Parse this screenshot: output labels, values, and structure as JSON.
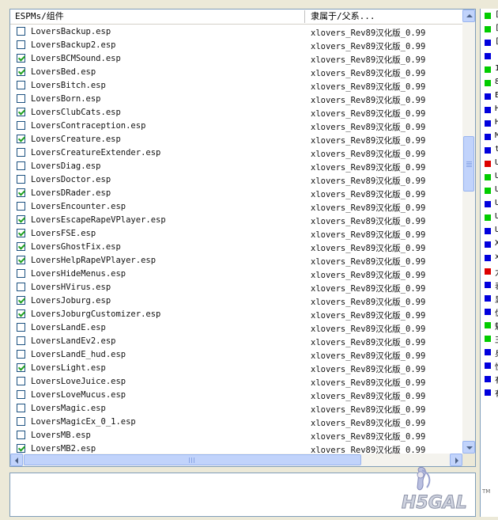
{
  "list": {
    "col_name": "ESPMs/组件",
    "col_parent": "隶属于/父系...",
    "rows": [
      {
        "name": "LoversBackup.esp",
        "parent": "xlovers_Rev89汉化版_0.99",
        "checked": false
      },
      {
        "name": "LoversBackup2.esp",
        "parent": "xlovers_Rev89汉化版_0.99",
        "checked": false
      },
      {
        "name": "LoversBCMSound.esp",
        "parent": "xlovers_Rev89汉化版_0.99",
        "checked": true
      },
      {
        "name": "LoversBed.esp",
        "parent": "xlovers_Rev89汉化版_0.99",
        "checked": true
      },
      {
        "name": "LoversBitch.esp",
        "parent": "xlovers_Rev89汉化版_0.99",
        "checked": false
      },
      {
        "name": "LoversBorn.esp",
        "parent": "xlovers_Rev89汉化版_0.99",
        "checked": false
      },
      {
        "name": "LoversClubCats.esp",
        "parent": "xlovers_Rev89汉化版_0.99",
        "checked": true
      },
      {
        "name": "LoversContraception.esp",
        "parent": "xlovers_Rev89汉化版_0.99",
        "checked": false
      },
      {
        "name": "LoversCreature.esp",
        "parent": "xlovers_Rev89汉化版_0.99",
        "checked": true
      },
      {
        "name": "LoversCreatureExtender.esp",
        "parent": "xlovers_Rev89汉化版_0.99",
        "checked": false
      },
      {
        "name": "LoversDiag.esp",
        "parent": "xlovers_Rev89汉化版_0.99",
        "checked": false
      },
      {
        "name": "LoversDoctor.esp",
        "parent": "xlovers_Rev89汉化版_0.99",
        "checked": false
      },
      {
        "name": "LoversDRader.esp",
        "parent": "xlovers_Rev89汉化版_0.99",
        "checked": true
      },
      {
        "name": "LoversEncounter.esp",
        "parent": "xlovers_Rev89汉化版_0.99",
        "checked": false
      },
      {
        "name": "LoversEscapeRapeVPlayer.esp",
        "parent": "xlovers_Rev89汉化版_0.99",
        "checked": true
      },
      {
        "name": "LoversFSE.esp",
        "parent": "xlovers_Rev89汉化版_0.99",
        "checked": true
      },
      {
        "name": "LoversGhostFix.esp",
        "parent": "xlovers_Rev89汉化版_0.99",
        "checked": true
      },
      {
        "name": "LoversHelpRapeVPlayer.esp",
        "parent": "xlovers_Rev89汉化版_0.99",
        "checked": true
      },
      {
        "name": "LoversHideMenus.esp",
        "parent": "xlovers_Rev89汉化版_0.99",
        "checked": false
      },
      {
        "name": "LoversHVirus.esp",
        "parent": "xlovers_Rev89汉化版_0.99",
        "checked": false
      },
      {
        "name": "LoversJoburg.esp",
        "parent": "xlovers_Rev89汉化版_0.99",
        "checked": true
      },
      {
        "name": "LoversJoburgCustomizer.esp",
        "parent": "xlovers_Rev89汉化版_0.99",
        "checked": true
      },
      {
        "name": "LoversLandE.esp",
        "parent": "xlovers_Rev89汉化版_0.99",
        "checked": false
      },
      {
        "name": "LoversLandEv2.esp",
        "parent": "xlovers_Rev89汉化版_0.99",
        "checked": false
      },
      {
        "name": "LoversLandE_hud.esp",
        "parent": "xlovers_Rev89汉化版_0.99",
        "checked": false
      },
      {
        "name": "LoversLight.esp",
        "parent": "xlovers_Rev89汉化版_0.99",
        "checked": true
      },
      {
        "name": "LoversLoveJuice.esp",
        "parent": "xlovers_Rev89汉化版_0.99",
        "checked": false
      },
      {
        "name": "LoversLoveMucus.esp",
        "parent": "xlovers_Rev89汉化版_0.99",
        "checked": false
      },
      {
        "name": "LoversMagic.esp",
        "parent": "xlovers_Rev89汉化版_0.99",
        "checked": false
      },
      {
        "name": "LoversMagicEx_0_1.esp",
        "parent": "xlovers_Rev89汉化版_0.99",
        "checked": false
      },
      {
        "name": "LoversMB.esp",
        "parent": "xlovers_Rev89汉化版_0.99",
        "checked": false
      },
      {
        "name": "LoversMB2.esp",
        "parent": "xlovers_Rev89汉化版_0.99",
        "checked": true
      }
    ]
  },
  "side_list": [
    {
      "color": "#00cc00",
      "text": "["
    },
    {
      "color": "#00cc00",
      "text": "["
    },
    {
      "color": "#0000dd",
      "text": "["
    },
    {
      "color": "#0000dd",
      "text": ""
    },
    {
      "color": "#00cc00",
      "text": "1"
    },
    {
      "color": "#00cc00",
      "text": "8"
    },
    {
      "color": "#0000dd",
      "text": "E"
    },
    {
      "color": "#0000dd",
      "text": "H"
    },
    {
      "color": "#0000dd",
      "text": "H"
    },
    {
      "color": "#0000dd",
      "text": "M"
    },
    {
      "color": "#0000dd",
      "text": "t"
    },
    {
      "color": "#dd0000",
      "text": "U"
    },
    {
      "color": "#00cc00",
      "text": "U"
    },
    {
      "color": "#00cc00",
      "text": "U"
    },
    {
      "color": "#0000dd",
      "text": "U"
    },
    {
      "color": "#00cc00",
      "text": "U"
    },
    {
      "color": "#0000dd",
      "text": "U"
    },
    {
      "color": "#0000dd",
      "text": "X"
    },
    {
      "color": "#0000dd",
      "text": "x"
    },
    {
      "color": "#dd0000",
      "text": "力"
    },
    {
      "color": "#0000dd",
      "text": "表"
    },
    {
      "color": "#0000dd",
      "text": "显"
    },
    {
      "color": "#0000dd",
      "text": "优"
    },
    {
      "color": "#00cc00",
      "text": "魅"
    },
    {
      "color": "#00cc00",
      "text": "王"
    },
    {
      "color": "#0000dd",
      "text": "身"
    },
    {
      "color": "#0000dd",
      "text": "性"
    },
    {
      "color": "#0000dd",
      "text": "有"
    },
    {
      "color": "#0000dd",
      "text": "有"
    }
  ],
  "watermark": {
    "text": "H5GAL",
    "tm": "TM"
  }
}
